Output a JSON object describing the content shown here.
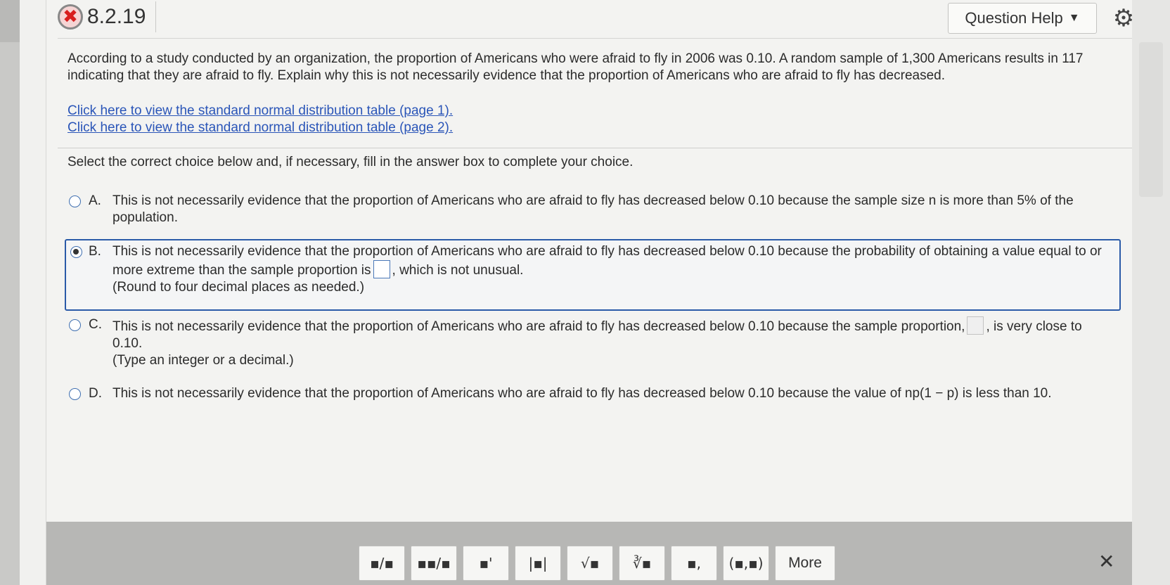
{
  "header": {
    "question_number": "8.2.19",
    "status_icon": "x-incorrect-icon",
    "help_label": "Question Help",
    "help_caret": "▼",
    "settings_icon": "gear-icon"
  },
  "question": {
    "text": "According to a study conducted by an organization, the proportion of Americans who were afraid to fly in 2006 was 0.10. A random sample of 1,300 Americans results in 117 indicating that they are afraid to fly. Explain why this is not necessarily evidence that the proportion of Americans who are afraid to fly has decreased."
  },
  "links": [
    "Click here to view the standard normal distribution table (page 1).",
    "Click here to view the standard normal distribution table (page 2)."
  ],
  "instruction": "Select the correct choice below and, if necessary, fill in the answer box to complete your choice.",
  "choices": {
    "a": {
      "letter": "A.",
      "text": "This is not necessarily evidence that the proportion of Americans who are afraid to fly has decreased below 0.10 because the sample size n is more than 5% of the population.",
      "selected": false
    },
    "b": {
      "letter": "B.",
      "text_before": "This is not necessarily evidence that the proportion of Americans who are afraid to fly has decreased below 0.10 because the probability of obtaining a value equal to or more extreme than the sample proportion is",
      "text_after": ", which is not unusual.",
      "hint": "(Round to four decimal places as needed.)",
      "answer_value": "",
      "selected": true
    },
    "c": {
      "letter": "C.",
      "text_before": "This is not necessarily evidence that the proportion of Americans who are afraid to fly has decreased below 0.10 because the sample proportion,",
      "text_after": ", is very close to 0.10.",
      "hint": "(Type an integer or a decimal.)",
      "answer_value": "",
      "selected": false
    },
    "d": {
      "letter": "D.",
      "text": "This is not necessarily evidence that the proportion of Americans who are afraid to fly has decreased below 0.10 because the value of np(1 − p) is less than 10.",
      "selected": false
    }
  },
  "toolbar": {
    "buttons": [
      {
        "name": "fraction-button",
        "glyph": "▪/▪"
      },
      {
        "name": "mixed-number-button",
        "glyph": "▪▪/▪"
      },
      {
        "name": "exponent-button",
        "glyph": "▪'"
      },
      {
        "name": "absolute-value-button",
        "glyph": "|▪|"
      },
      {
        "name": "square-root-button",
        "glyph": "√▪"
      },
      {
        "name": "nth-root-button",
        "glyph": "∛▪"
      },
      {
        "name": "subscript-button",
        "glyph": "▪,"
      },
      {
        "name": "ordered-pair-button",
        "glyph": "(▪,▪)"
      }
    ],
    "more_label": "More",
    "close_icon": "close-icon",
    "close_glyph": "✕"
  }
}
